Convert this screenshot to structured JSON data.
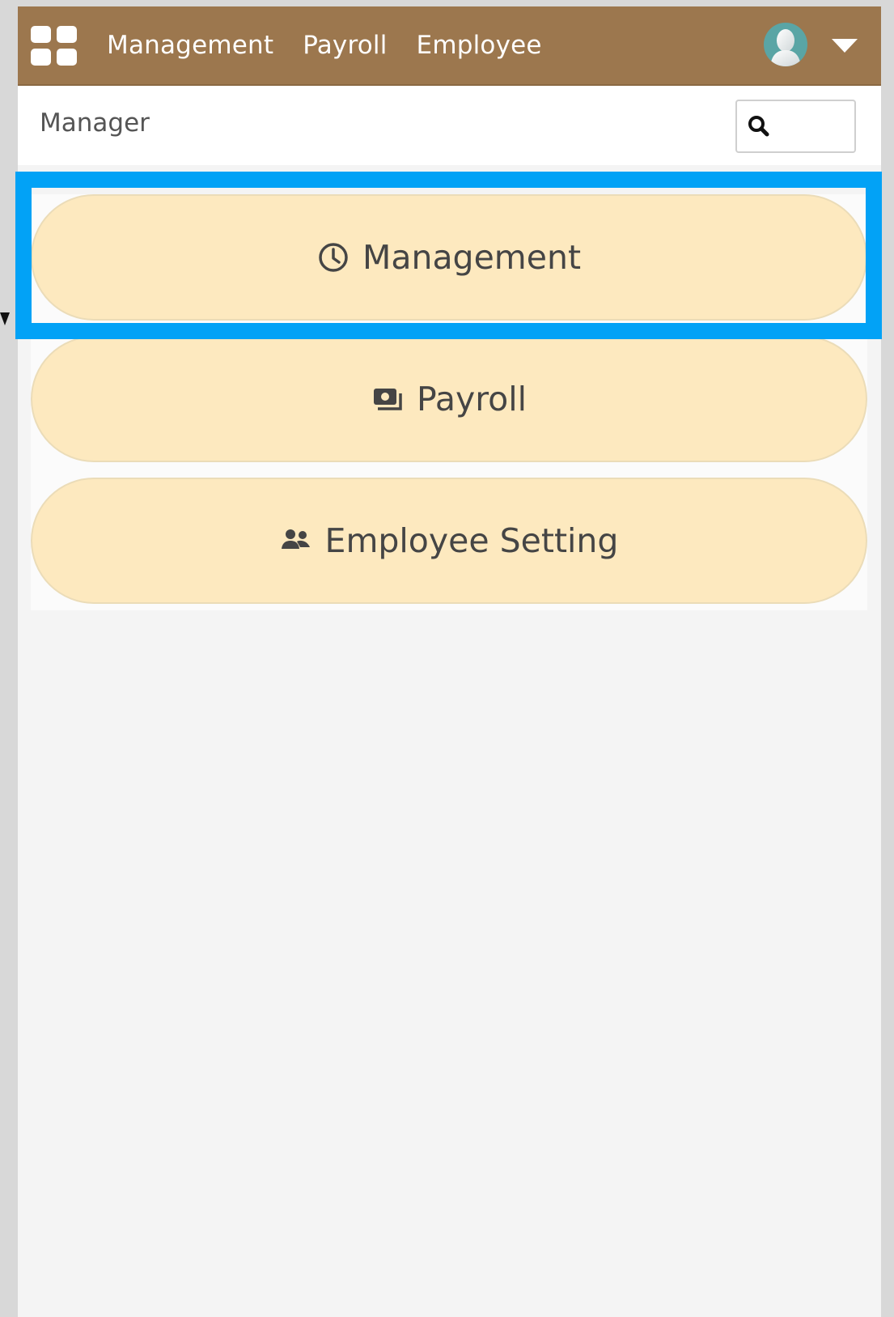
{
  "topbar": {
    "nav_items": [
      "Management",
      "Payroll",
      "Employee"
    ],
    "icons": {
      "apps": "apps-grid-icon",
      "avatar": "user-avatar",
      "dropdown": "caret-down-icon"
    },
    "color": "#9c774e"
  },
  "subbar": {
    "title": "Manager",
    "search": {
      "placeholder": "",
      "value": "",
      "icon": "search-icon"
    }
  },
  "menu": {
    "buttons": [
      {
        "label": "Management",
        "icon": "clock-icon"
      },
      {
        "label": "Payroll",
        "icon": "money-icon"
      },
      {
        "label": "Employee Setting",
        "icon": "users-icon"
      }
    ],
    "button_color": "#fde9bf",
    "highlight_color": "#02a2f6"
  }
}
